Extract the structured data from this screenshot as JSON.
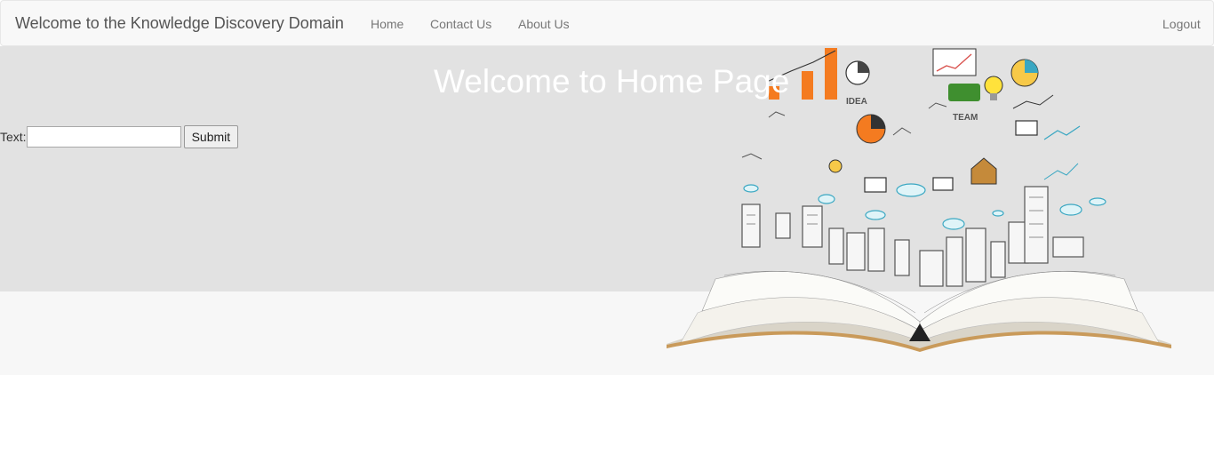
{
  "navbar": {
    "brand": "Welcome to the Knowledge Discovery Domain",
    "links": [
      "Home",
      "Contact Us",
      "About Us"
    ],
    "logout": "Logout"
  },
  "hero": {
    "title": "Welcome to Home Page",
    "illustration_icon": "open-book-knowledge-city-icon"
  },
  "form": {
    "label": "Text:",
    "input_value": "",
    "submit": "Submit"
  },
  "colors": {
    "navbar_bg": "#f8f8f8",
    "hero_bg": "#e2e2e2",
    "accent_orange": "#f47b20"
  }
}
